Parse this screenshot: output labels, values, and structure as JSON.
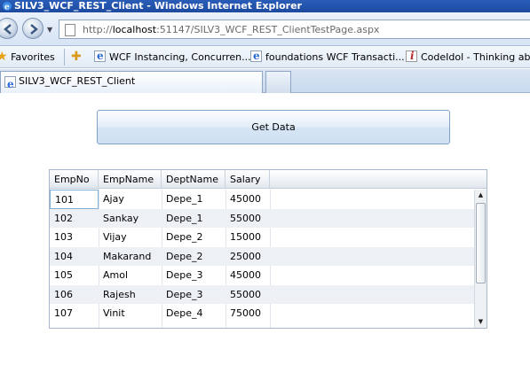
{
  "window": {
    "title": "SILV3_WCF_REST_Client - Windows Internet Explorer"
  },
  "address": {
    "url_prefix": "http://",
    "url_host": "localhost",
    "url_rest": ":51147/SILV3_WCF_REST_ClientTestPage.aspx"
  },
  "favorites": {
    "label": "Favorites",
    "items": [
      {
        "label": "WCF Instancing, Concurren...",
        "icon": "ie-page-icon"
      },
      {
        "label": "foundations WCF Transacti...",
        "icon": "ie-page-icon"
      },
      {
        "label": "CodeIdol - Thinking about",
        "icon": "codeidol-icon"
      }
    ]
  },
  "tab": {
    "label": "SILV3_WCF_REST_Client"
  },
  "button": {
    "get_data": "Get Data"
  },
  "grid": {
    "columns": [
      "EmpNo",
      "EmpName",
      "DeptName",
      "Salary"
    ],
    "rows": [
      [
        "101",
        "Ajay",
        "Depe_1",
        "45000"
      ],
      [
        "102",
        "Sankay",
        "Depe_1",
        "55000"
      ],
      [
        "103",
        "Vijay",
        "Depe_2",
        "15000"
      ],
      [
        "104",
        "Makarand",
        "Depe_2",
        "25000"
      ],
      [
        "105",
        "Amol",
        "Depe_3",
        "45000"
      ],
      [
        "106",
        "Rajesh",
        "Depe_3",
        "55000"
      ],
      [
        "107",
        "Vinit",
        "Depe_4",
        "75000"
      ]
    ]
  },
  "colors": {
    "titlebar": "#1d4aa0",
    "button_border": "#7fa4cc",
    "grid_alt_row": "#edf1f6"
  }
}
